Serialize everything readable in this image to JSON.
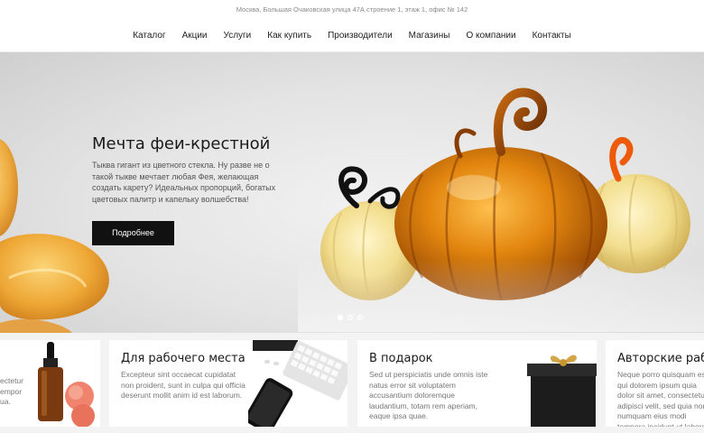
{
  "topbar": {
    "address": "Москва, Большая Очаковская улица 47А строение 1, этаж 1, офис № 142"
  },
  "nav": {
    "items": [
      "Каталог",
      "Акции",
      "Услуги",
      "Как купить",
      "Производители",
      "Магазины",
      "О компании",
      "Контакты"
    ]
  },
  "hero": {
    "title": "Мечта феи-крестной",
    "text": "Тыква гигант из цветного стекла. Ну разве не о такой тыкве мечтает любая Фея, желающая создать карету? Идеальных пропорций, богатых цветовых палитр и капельку волшебства!",
    "button": "Подробнее",
    "slides": 3,
    "active_slide": 1
  },
  "cards": [
    {
      "title": "",
      "text": "ectetur\nempor\nua."
    },
    {
      "title": "Для рабочего места",
      "text": "Excepteur sint occaecat cupidatat non proident, sunt in culpa qui officia deserunt mollit anim id est laborum."
    },
    {
      "title": "В подарок",
      "text": "Sed ut perspiciatis unde omnis iste natus error sit voluptatem accusantium doloremque laudantium, totam rem aperiam, eaque ipsa quae."
    },
    {
      "title": "Авторские раб",
      "text": "Neque porro quisquam est, qui dolorem ipsum quia dolor sit amet, consectetur, adipisci velit, sed quia non numquam eius modi tempora incidunt ut labore et dolore magnam aliquam quaerat voluptatem."
    }
  ],
  "colors": {
    "button_bg": "#111111",
    "hero_bg": "#e3e3e3",
    "amber": "#c86f0a",
    "pale_gold": "#f1dc8a"
  }
}
